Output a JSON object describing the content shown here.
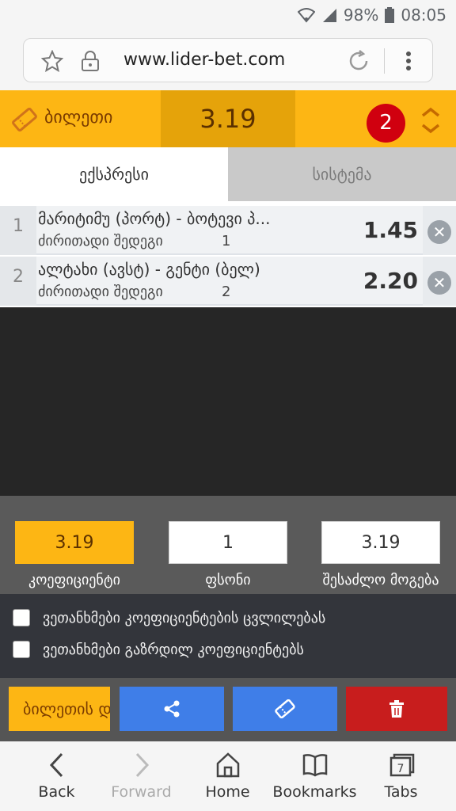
{
  "status_bar": {
    "battery": "98%",
    "time": "08:05"
  },
  "browser": {
    "url": "www.lider-bet.com"
  },
  "betslip": {
    "title": "ბილეთი",
    "total_odds": "3.19",
    "selection_count": "2",
    "tabs": [
      {
        "label": "ექსპრესი",
        "active": true
      },
      {
        "label": "სისტემა",
        "active": false
      }
    ],
    "bets": [
      {
        "num": "1",
        "event": "მარიტიმუ (პორტ) - ბოტევი პ...",
        "market": "ძირითადი შედეგი",
        "outcome": "1",
        "odds": "1.45"
      },
      {
        "num": "2",
        "event": "ალტახი (ავსტ) - გენტი (ბელ)",
        "market": "ძირითადი შედეგი",
        "outcome": "2",
        "odds": "2.20"
      }
    ],
    "stake_panel": {
      "odds_value": "3.19",
      "odds_label": "კოეფიციენტი",
      "stake_value": "1",
      "stake_label": "ფსონი",
      "win_value": "3.19",
      "win_label": "შესაძლო მოგება"
    },
    "agreements": [
      "ვეთანხმები კოეფიციენტების ცვლილებას",
      "ვეთანხმები გაზრდილ კოეფიციენტებს"
    ],
    "actions": {
      "slip_label": "ბილეთის დ",
      "share_icon": "share-icon",
      "ticket_icon": "ticket-icon",
      "delete_icon": "trash-icon"
    }
  },
  "bottom_nav": [
    {
      "label": "Back",
      "icon": "chevron-left-icon"
    },
    {
      "label": "Forward",
      "icon": "chevron-right-icon"
    },
    {
      "label": "Home",
      "icon": "home-icon"
    },
    {
      "label": "Bookmarks",
      "icon": "book-icon"
    },
    {
      "label": "Tabs",
      "icon": "tabs-icon",
      "count": "7"
    }
  ],
  "colors": {
    "accent": "#fdb614",
    "danger": "#c81d1d",
    "primary": "#3f7ee8",
    "badge": "#d0000f"
  }
}
